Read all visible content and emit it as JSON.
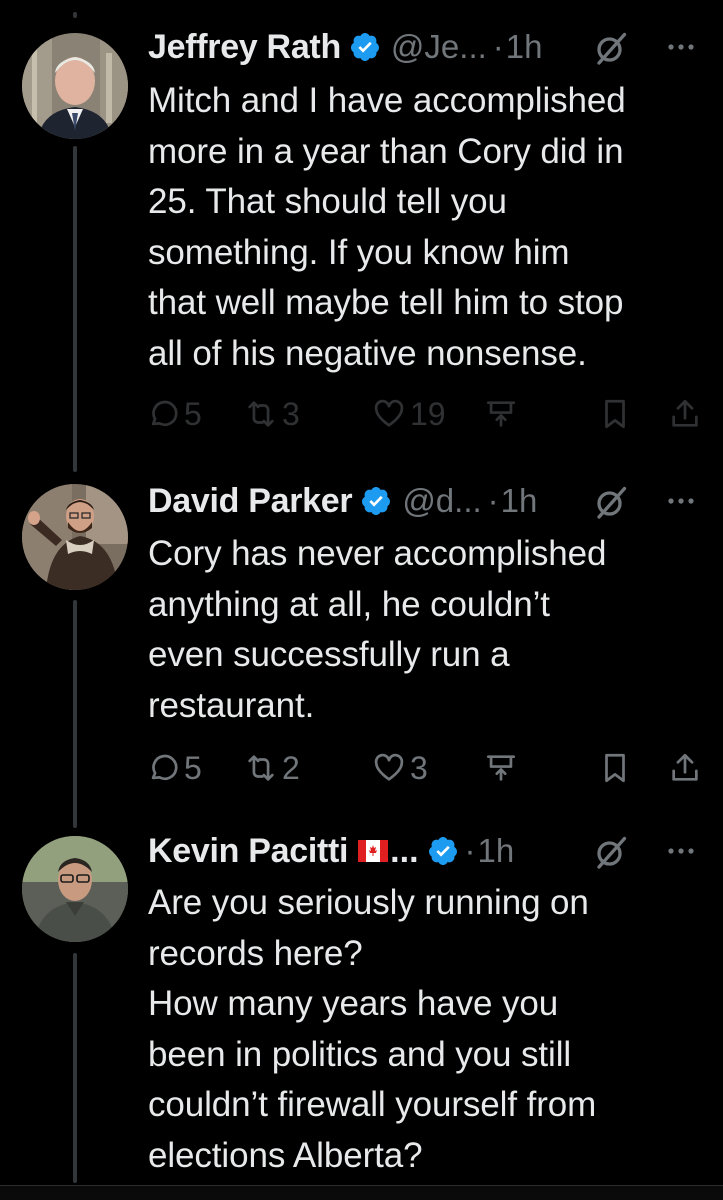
{
  "tweets": [
    {
      "name": "Jeffrey Rath",
      "handle": "@Je...",
      "separator": "·",
      "time": "1h",
      "lines": [
        "Mitch and I have accomplished",
        "more in a year than Cory did in",
        "25. That should tell you",
        "something. If you know him",
        "that well maybe tell him to stop",
        "all of his negative nonsense."
      ],
      "replies": "5",
      "reposts": "3",
      "likes": "19"
    },
    {
      "name": "David Parker",
      "handle": "@d...",
      "separator": "·",
      "time": "1h",
      "lines": [
        "Cory has never accomplished",
        "anything at all, he couldn’t",
        "even successfully run a",
        "restaurant."
      ],
      "replies": "5",
      "reposts": "2",
      "likes": "3"
    },
    {
      "name": "Kevin Pacitti",
      "name_ellipsis": "...",
      "separator": "·",
      "time": "1h",
      "lines": [
        "Are you seriously running on",
        "records here?",
        "How many years have you",
        "been in politics and you still",
        "couldn’t firewall yourself from",
        "elections Alberta?"
      ]
    }
  ],
  "icons": {
    "verified": "verified-badge-icon",
    "grok": "grok-icon",
    "more": "more-icon",
    "reply": "reply-icon",
    "repost": "repost-icon",
    "like": "like-icon",
    "analytics": "analytics-icon",
    "bookmark": "bookmark-icon",
    "share": "share-icon",
    "flag": "canada-flag-icon"
  },
  "colors": {
    "background": "#000000",
    "text": "#e7e9ea",
    "muted": "#71767b",
    "verified": "#1d9bf0",
    "thread_line": "#333639"
  }
}
